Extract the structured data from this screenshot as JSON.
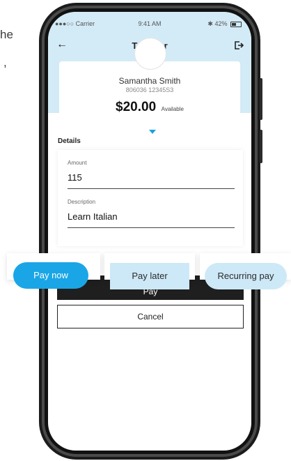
{
  "background_snippets": {
    "line1": "he",
    "line2": ","
  },
  "status_bar": {
    "carrier": "●●●○○ Carrier",
    "time": "9:41 AM",
    "battery": "42%"
  },
  "nav": {
    "title": "Transfer",
    "back_icon": "back-arrow-icon",
    "right_icon": "logout-icon"
  },
  "recipient": {
    "name": "Samantha Smith",
    "account": "806036 12345S3",
    "balance": "$20.00",
    "balance_label": "Available"
  },
  "details": {
    "section_title": "Details",
    "amount_label": "Amount",
    "amount_value": "115",
    "description_label": "Description",
    "description_value": "Learn Italian"
  },
  "actions": {
    "pay_label": "Pay",
    "cancel_label": "Cancel"
  },
  "payment_options": [
    {
      "label": "Pay now",
      "selected": true
    },
    {
      "label": "Pay later",
      "selected": false
    },
    {
      "label": "Recurring pay",
      "selected": false
    }
  ],
  "colors": {
    "accent": "#1aa6e6",
    "light_accent": "#cde9f7",
    "header_band": "#d3ebf7",
    "dark_button": "#1f1f1f"
  }
}
